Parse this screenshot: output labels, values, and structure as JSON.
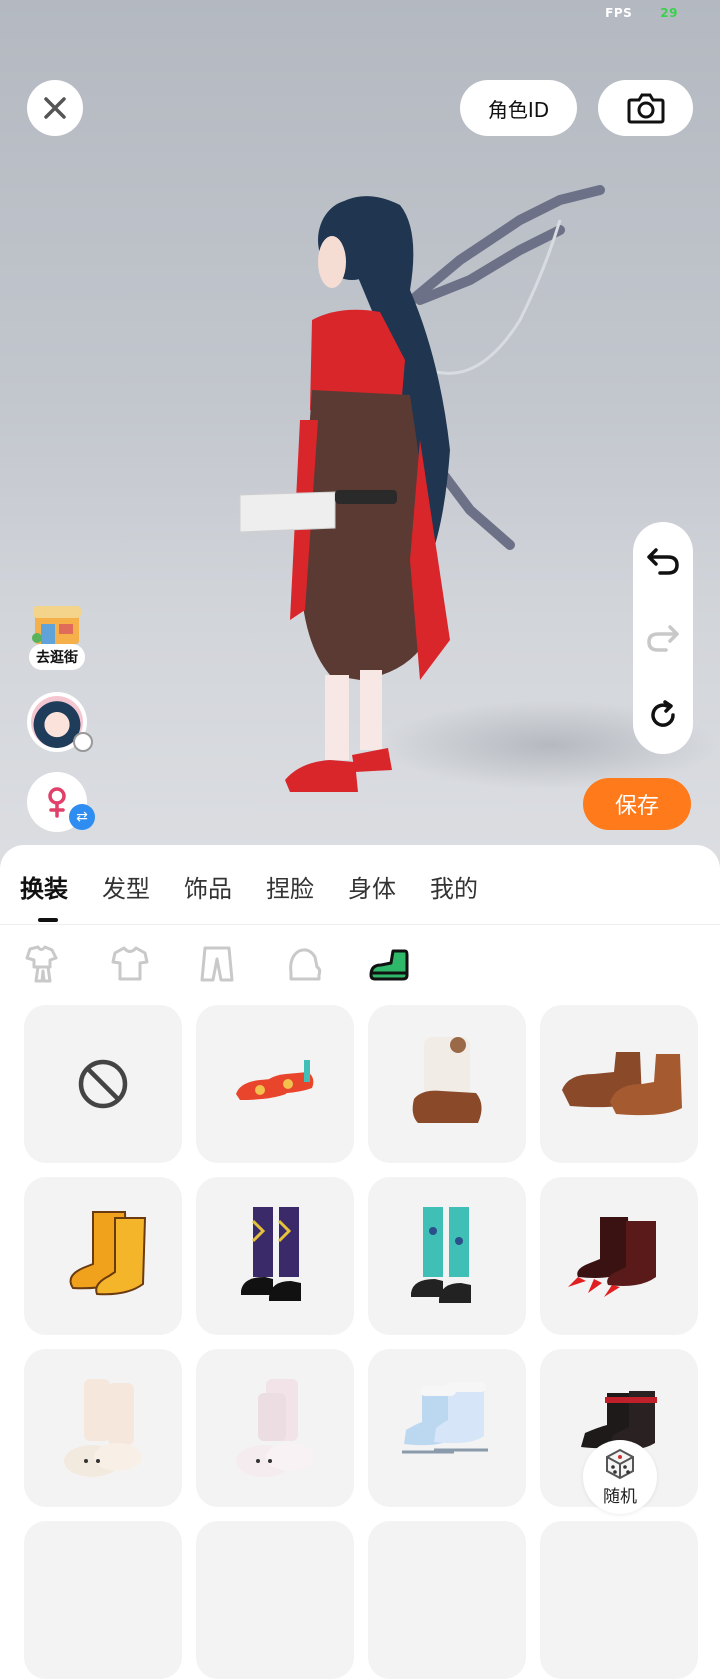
{
  "status": {
    "fps_label": "FPS",
    "fps_value": "29"
  },
  "header": {
    "role_id_label": "角色ID"
  },
  "actions": {
    "save_label": "保存",
    "street_label": "去逛街",
    "random_label": "随机"
  },
  "tabs": [
    {
      "label": "换装",
      "active": true
    },
    {
      "label": "发型",
      "active": false
    },
    {
      "label": "饰品",
      "active": false
    },
    {
      "label": "捏脸",
      "active": false
    },
    {
      "label": "身体",
      "active": false
    },
    {
      "label": "我的",
      "active": false
    }
  ],
  "subcategories": [
    {
      "icon": "full-outfit-icon",
      "active": false
    },
    {
      "icon": "top-shirt-icon",
      "active": false
    },
    {
      "icon": "pants-icon",
      "active": false
    },
    {
      "icon": "gloves-icon",
      "active": false
    },
    {
      "icon": "shoes-icon",
      "active": true
    }
  ],
  "items": [
    {
      "name": "none-item",
      "icon": "none-icon",
      "color": "#444444",
      "selected": false
    },
    {
      "name": "red-embroidered-shoes",
      "icon": "shoe-icon",
      "color": "#e8452c",
      "selected": false
    },
    {
      "name": "fluffy-bear-boots",
      "icon": "boot-icon",
      "color": "#f2ece6",
      "selected": false
    },
    {
      "name": "brown-paw-slippers",
      "icon": "slipper-icon",
      "color": "#8a4a2a",
      "selected": false
    },
    {
      "name": "tiger-paw-boots",
      "icon": "boot-icon",
      "color": "#f0a21c",
      "selected": false
    },
    {
      "name": "argyle-socks-shoes",
      "icon": "sock-shoe-icon",
      "color": "#3a2a6a",
      "selected": false
    },
    {
      "name": "teal-socks-shoes",
      "icon": "sock-shoe-icon",
      "color": "#3fbfb5",
      "selected": false
    },
    {
      "name": "claw-boots",
      "icon": "claw-icon",
      "color": "#5a1a1a",
      "selected": false
    },
    {
      "name": "bunny-slippers-white",
      "icon": "slipper-icon",
      "color": "#f6e7dc",
      "selected": false
    },
    {
      "name": "bunny-slippers-pink",
      "icon": "slipper-icon",
      "color": "#f1e3e8",
      "selected": false
    },
    {
      "name": "holo-ice-skates",
      "icon": "skate-icon",
      "color": "#bcd8f0",
      "selected": false
    },
    {
      "name": "black-red-ankle-boots",
      "icon": "boot-icon",
      "color": "#1f1a1a",
      "selected": false
    }
  ],
  "colors": {
    "accent": "#ff7a1a",
    "swap_blue": "#2f8cf0",
    "card_bg": "#f3f3f4",
    "active_shoes": "#2fb86a"
  }
}
